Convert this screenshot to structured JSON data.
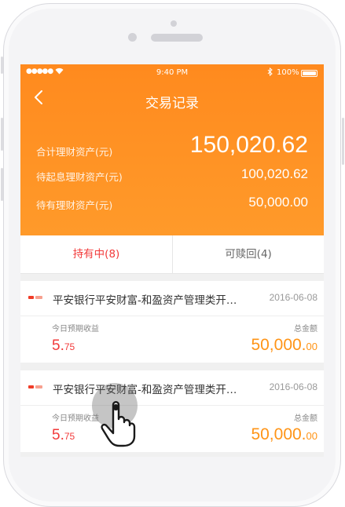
{
  "status_bar": {
    "signal": "●●●●●",
    "time": "9:40 PM",
    "battery": "100%",
    "icons": [
      "wifi-icon",
      "bluetooth-icon",
      "battery-icon"
    ]
  },
  "header": {
    "title": "交易记录",
    "back_icon": "chevron-left-icon"
  },
  "summary": {
    "total_label": "合计理财资产(元)",
    "total_value": "150,020.62",
    "pending_label": "待起息理财资产(元)",
    "pending_value": "100,020.62",
    "holding_label": "待有理财资产(元)",
    "holding_value": "50,000.00"
  },
  "tabs": [
    {
      "label": "持有中(8)",
      "active": true
    },
    {
      "label": "可赎回(4)",
      "active": false
    }
  ],
  "products": [
    {
      "name": "平安银行平安财富-和盈资产管理类开…",
      "date": "2016-06-08",
      "yield_label": "今日预期收益",
      "yield_int": "5.",
      "yield_dec": "75",
      "amount_label": "总金额",
      "amount_int": "50,000.",
      "amount_dec": "00"
    },
    {
      "name": "平安银行平安财富-和盈资产管理类开…",
      "date": "2016-06-08",
      "yield_label": "今日预期收益",
      "yield_int": "5.",
      "yield_dec": "75",
      "amount_label": "总金额",
      "amount_int": "50,000.",
      "amount_dec": "00"
    }
  ],
  "colors": {
    "accent_orange": "#ff8a1e",
    "active_red": "#f23a3a",
    "amount_orange": "#ff9416"
  }
}
